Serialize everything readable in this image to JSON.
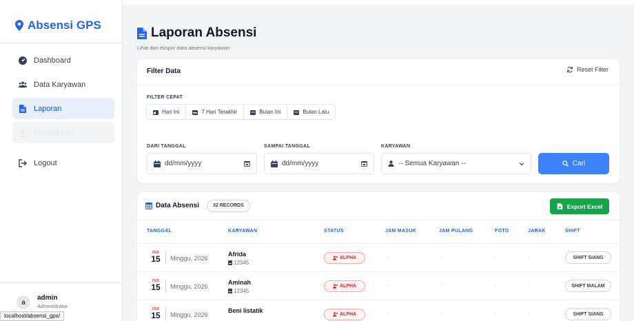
{
  "brand": "Absensi GPS",
  "sidebar": {
    "items": [
      {
        "label": "Dashboard"
      },
      {
        "label": "Data Karyawan"
      },
      {
        "label": "Laporan"
      },
      {
        "label": "Pengaturan"
      },
      {
        "label": "Logout"
      }
    ],
    "user": {
      "initial": "a",
      "name": "admin",
      "role": "Administrator"
    }
  },
  "status_url": "localhost/absensi_gps/",
  "header": {
    "title": "Laporan Absensi",
    "subtitle": "Lihat dan ekspor data absensi karyawan"
  },
  "filter": {
    "title": "Filter Data",
    "reset_label": "Reset Filter",
    "quick_label": "FILTER CEPAT",
    "quick": [
      "Hari Ini",
      "7 Hari Terakhir",
      "Bulan Ini",
      "Bulan Lalu"
    ],
    "from_label": "DARI TANGGAL",
    "to_label": "SAMPAI TANGGAL",
    "employee_label": "KARYAWAN",
    "from_placeholder": "dd/mm/yyyy",
    "to_placeholder": "dd/mm/yyyy",
    "employee_value": "-- Semua Karyawan --",
    "search_label": "Cari"
  },
  "data": {
    "title": "Data Absensi",
    "records": "32 RECORDS",
    "export_label": "Export Excel",
    "columns": [
      "TANGGAL",
      "KARYAWAN",
      "STATUS",
      "JAM MASUK",
      "JAM PULANG",
      "FOTO",
      "JARAK",
      "SHIFT"
    ],
    "rows": [
      {
        "month": "FEB",
        "day": "15",
        "day_name": "Minggu, 2026",
        "name": "Afrida",
        "id": "12345",
        "status": "ALPHA",
        "jam_masuk": "-",
        "jam_pulang": "-",
        "foto": "-",
        "jarak": "-",
        "shift": "SHIFT SIANG"
      },
      {
        "month": "FEB",
        "day": "15",
        "day_name": "Minggu, 2026",
        "name": "Aminah",
        "id": "12345",
        "status": "ALPHA",
        "jam_masuk": "-",
        "jam_pulang": "-",
        "foto": "-",
        "jarak": "-",
        "shift": "SHIFT MALAM"
      },
      {
        "month": "FEB",
        "day": "15",
        "day_name": "Minggu, 2026",
        "name": "Beni listatik",
        "id": "",
        "status": "ALPHA",
        "jam_masuk": "-",
        "jam_pulang": "-",
        "foto": "-",
        "jarak": "-",
        "shift": "SHIFT SIANG"
      }
    ]
  },
  "colors": {
    "primary": "#3b82f6",
    "brand": "#2563eb",
    "success": "#16a34a",
    "danger": "#dc2626"
  }
}
